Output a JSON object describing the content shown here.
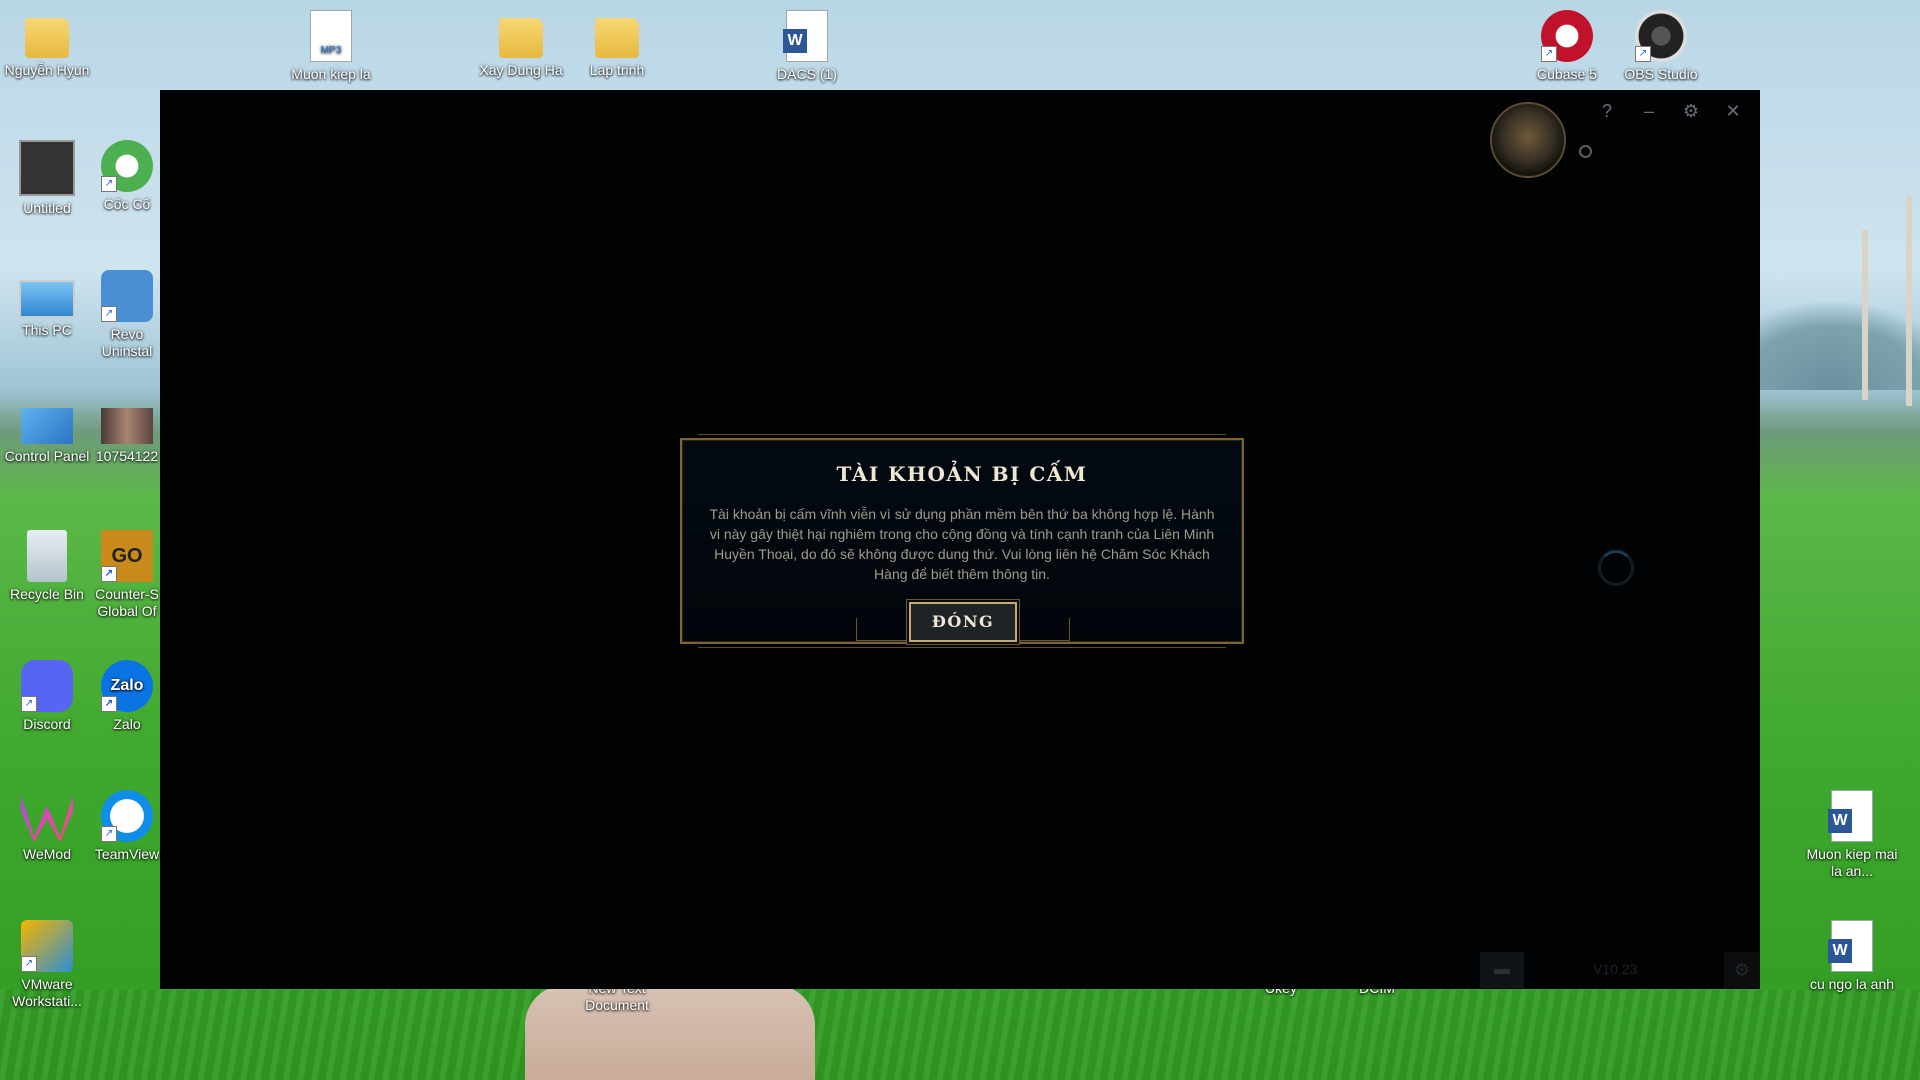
{
  "desktop": {
    "icons": [
      {
        "label": "Nguyễn Hyun"
      },
      {
        "label": "Muon kiep la"
      },
      {
        "label": "Xay Dung Ha"
      },
      {
        "label": "Lap trinh"
      },
      {
        "label": "DACS (1)"
      },
      {
        "label": "Cubase 5"
      },
      {
        "label": "OBS Studio"
      },
      {
        "label": "Untitled"
      },
      {
        "label": "Cốc Cố"
      },
      {
        "label": "This PC"
      },
      {
        "label": "Revo Uninstal"
      },
      {
        "label": "Control Panel"
      },
      {
        "label": "10754122"
      },
      {
        "label": "Recycle Bin"
      },
      {
        "label": "Counter-S Global Of"
      },
      {
        "label": "Discord"
      },
      {
        "label": "Zalo"
      },
      {
        "label": "WeMod"
      },
      {
        "label": "TeamView"
      },
      {
        "label": "VMware Workstati..."
      },
      {
        "label": "New Text Document"
      },
      {
        "label": "Ukey"
      },
      {
        "label": "DCIM"
      },
      {
        "label": "Muon kiep mai la an..."
      },
      {
        "label": "cu ngo la anh"
      }
    ],
    "misc": {
      "mp3_badge": "MP3",
      "word_badge": "W",
      "zalo_badge": "Zalo",
      "csgo_badge": "GO"
    }
  },
  "client": {
    "controls": {
      "help": "?",
      "minimize": "–",
      "settings": "⚙",
      "close": "✕"
    },
    "version": "V10.23",
    "chat_icon": "speech-bubble-icon",
    "accent": "#c8aa6e"
  },
  "modal": {
    "title": "TÀI KHOẢN BỊ CẤM",
    "message": "Tài khoản bị cấm vĩnh viễn vì sử dụng phần mềm bên thứ ba không hợp lệ. Hành vi này gây thiệt hại nghiêm trong cho cộng đồng và tính cạnh tranh của Liên Minh Huyền Thoại, do đó sẽ không được dung thứ. Vui lòng liên hệ Chăm Sóc Khách Hàng để biết thêm thông tin.",
    "button_label": "ĐÓNG"
  }
}
